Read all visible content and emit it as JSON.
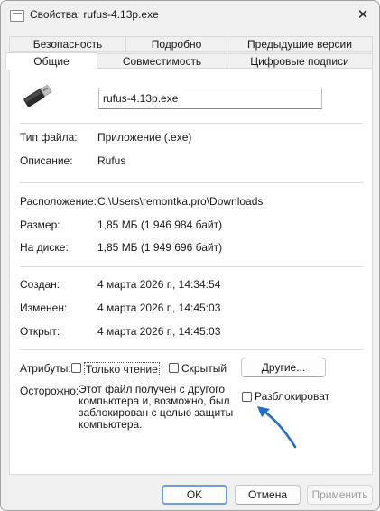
{
  "window": {
    "title": "Свойства: rufus-4.13p.exe",
    "close_glyph": "✕"
  },
  "tabs": {
    "row1": [
      "Безопасность",
      "Подробно",
      "Предыдущие версии"
    ],
    "row2": [
      "Общие",
      "Совместимость",
      "Цифровые подписи"
    ],
    "active": "Общие"
  },
  "general": {
    "file_name": "rufus-4.13p.exe",
    "type_label": "Тип файла:",
    "type_value": "Приложение (.exe)",
    "description_label": "Описание:",
    "description_value": "Rufus",
    "location_label": "Расположение:",
    "location_value": "C:\\Users\\remontka.pro\\Downloads",
    "size_label": "Размер:",
    "size_value": "1,85 МБ (1 946 984 байт)",
    "disk_size_label": "На диске:",
    "disk_size_value": "1,85 МБ (1 949 696 байт)",
    "created_label": "Создан:",
    "created_value": "4 марта 2026 г., 14:34:54",
    "modified_label": "Изменен:",
    "modified_value": "4 марта 2026 г., 14:45:03",
    "accessed_label": "Открыт:",
    "accessed_value": "4 марта 2026 г., 14:45:03",
    "attributes_label": "Атрибуты:",
    "readonly_label": "Только чтение",
    "readonly_checked": false,
    "hidden_label": "Скрытый",
    "hidden_checked": false,
    "other_button": "Другие...",
    "caution_label": "Осторожно:",
    "caution_text": "Этот файл получен с другого\nкомпьютера и, возможно, был\nзаблокирован с целью защиты\nкомпьютера.",
    "unblock_label": "Разблокироват",
    "unblock_checked": false
  },
  "footer": {
    "ok": "OK",
    "cancel": "Отмена",
    "apply": "Применить"
  },
  "colors": {
    "accent": "#1f6fd1",
    "arrow": "#1f6fd1"
  },
  "icons": {
    "file_icon": "usb-drive-icon",
    "window_icon": "properties-window-icon",
    "close": "close-icon"
  }
}
